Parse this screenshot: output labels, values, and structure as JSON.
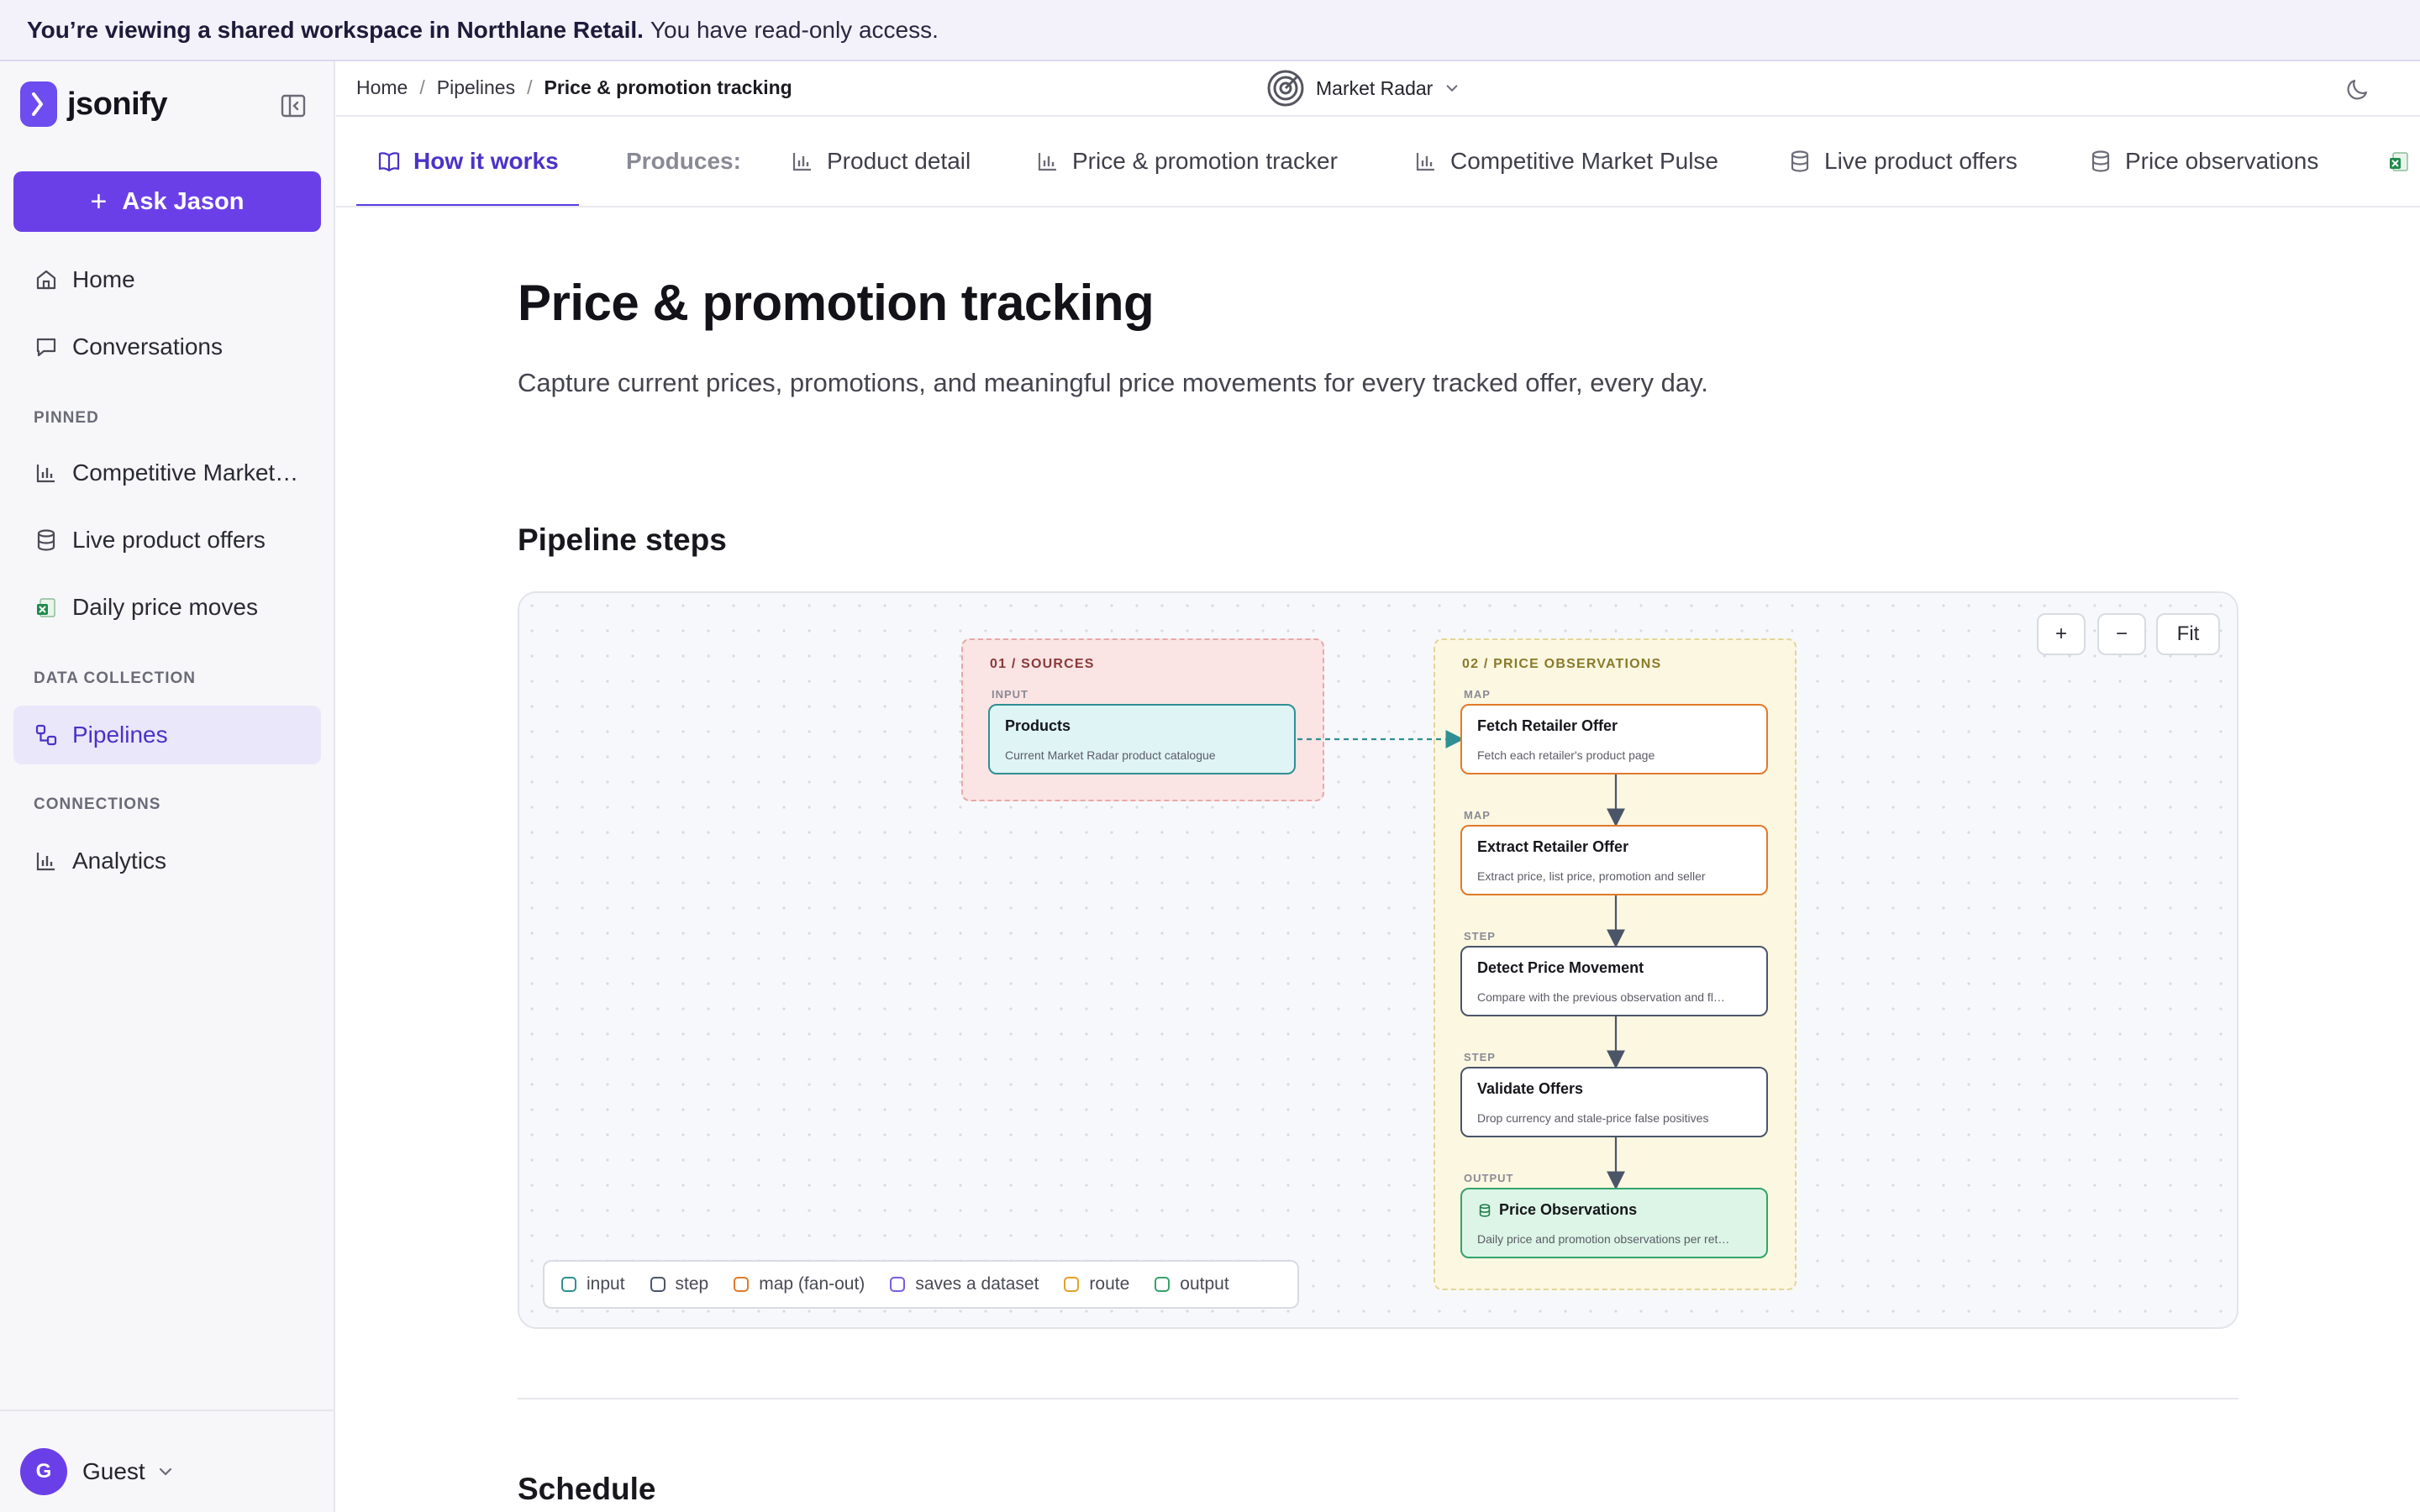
{
  "banner": {
    "bold_text": "You’re viewing a shared workspace in Northlane Retail.",
    "text": "You have read-only access."
  },
  "sidebar": {
    "brand": "jsonify",
    "ask_button": "Ask Jason",
    "nav_top": [
      {
        "label": "Home",
        "icon": "home-icon"
      },
      {
        "label": "Conversations",
        "icon": "chat-icon"
      }
    ],
    "pinned_label": "PINNED",
    "pinned": [
      {
        "label": "Competitive Market…",
        "icon": "bar-chart-icon"
      },
      {
        "label": "Live product offers",
        "icon": "database-icon"
      },
      {
        "label": "Daily price moves",
        "icon": "excel-icon"
      }
    ],
    "data_collection_label": "DATA COLLECTION",
    "data_collection": [
      {
        "label": "Pipelines",
        "icon": "pipeline-icon",
        "active": true
      }
    ],
    "connections_label": "CONNECTIONS",
    "connections": [
      {
        "label": "Analytics",
        "icon": "bar-chart-icon"
      }
    ],
    "user": {
      "initial": "G",
      "name": "Guest"
    }
  },
  "header": {
    "breadcrumbs": [
      "Home",
      "Pipelines",
      "Price & promotion tracking"
    ],
    "project": "Market Radar"
  },
  "tabs": {
    "how_it_works": "How it works",
    "produces_label": "Produces:",
    "items": [
      {
        "label": "Product detail",
        "icon": "bar-chart-icon"
      },
      {
        "label": "Price & promotion tracker",
        "icon": "bar-chart-icon"
      },
      {
        "label": "Competitive Market Pulse",
        "icon": "bar-chart-icon"
      },
      {
        "label": "Live product offers",
        "icon": "database-icon"
      },
      {
        "label": "Price observations",
        "icon": "database-icon"
      }
    ]
  },
  "main": {
    "title": "Price & promotion tracking",
    "description": "Capture current prices, promotions, and meaningful price movements for every tracked offer, every day.",
    "pipeline_heading": "Pipeline steps",
    "schedule_heading": "Schedule"
  },
  "diagram": {
    "zoom_in": "+",
    "zoom_out": "−",
    "fit": "Fit",
    "groups": [
      {
        "title": "01 / SOURCES"
      },
      {
        "title": "02 / PRICE OBSERVATIONS"
      }
    ],
    "nodes": [
      {
        "kind": "INPUT",
        "title": "Products",
        "subtitle": "Current Market Radar product catalogue"
      },
      {
        "kind": "MAP",
        "title": "Fetch Retailer Offer",
        "subtitle": "Fetch each retailer's product page"
      },
      {
        "kind": "MAP",
        "title": "Extract Retailer Offer",
        "subtitle": "Extract price, list price, promotion and seller"
      },
      {
        "kind": "STEP",
        "title": "Detect Price Movement",
        "subtitle": "Compare with the previous observation and fl…"
      },
      {
        "kind": "STEP",
        "title": "Validate Offers",
        "subtitle": "Drop currency and stale-price false positives"
      },
      {
        "kind": "OUTPUT",
        "title": "Price Observations",
        "subtitle": "Daily price and promotion observations per ret…"
      }
    ],
    "legend": [
      {
        "label": "input",
        "color": "#2f8f94"
      },
      {
        "label": "step",
        "color": "#4a5568"
      },
      {
        "label": "map (fan-out)",
        "color": "#e07a2a"
      },
      {
        "label": "saves a dataset",
        "color": "#7a5ce0"
      },
      {
        "label": "route",
        "color": "#e3a02a"
      },
      {
        "label": "output",
        "color": "#34a36a"
      }
    ]
  },
  "colors": {
    "accent": "#6b3fe8",
    "active_tab": "#4b32c8",
    "banner_bg": "#f3f2fa"
  }
}
